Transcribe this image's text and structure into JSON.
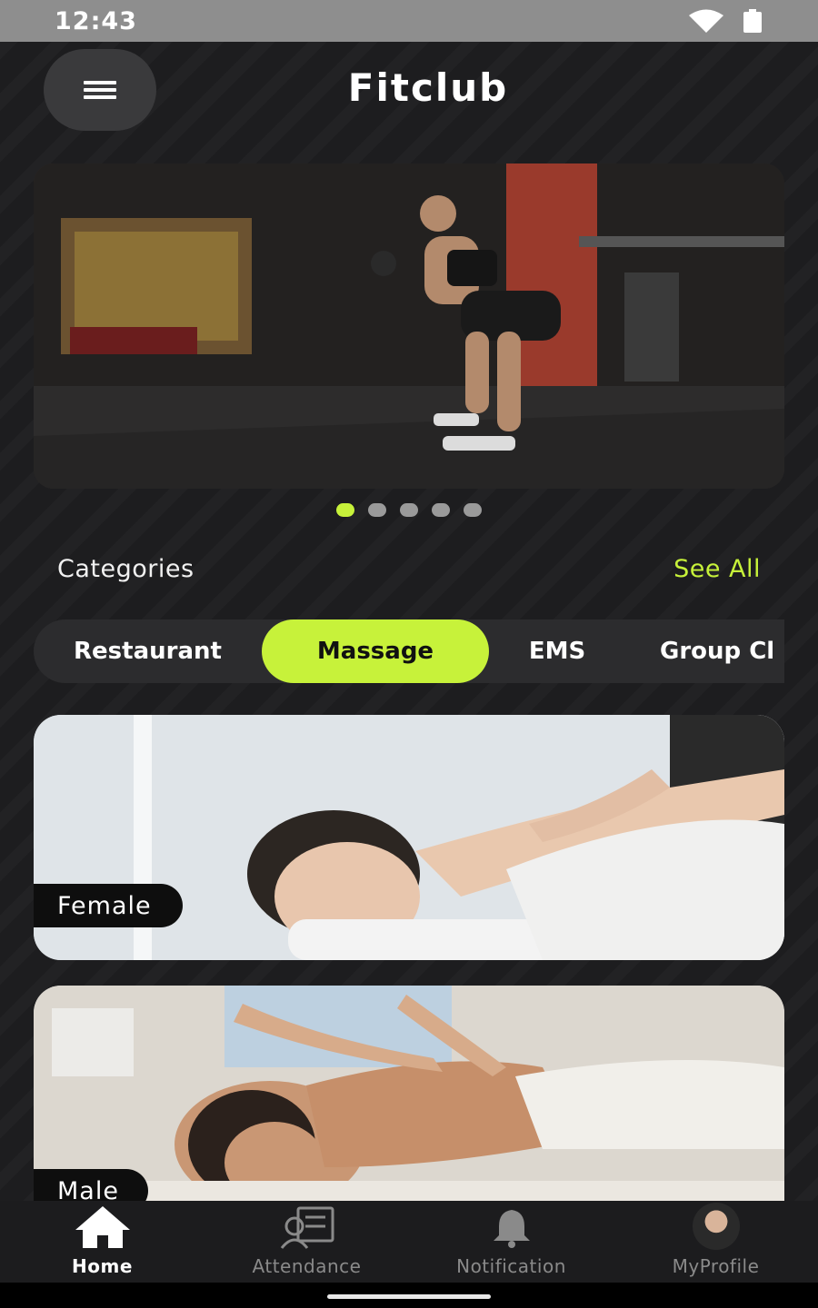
{
  "status_bar": {
    "time": "12:43",
    "icons": [
      "wifi-icon",
      "battery-icon"
    ]
  },
  "header": {
    "title": "Fitclub",
    "menu_icon": "hamburger-menu-icon"
  },
  "banner": {
    "image": "woman-squatting-in-gym-photo",
    "slide_count": 5,
    "active_slide": 1
  },
  "categories": {
    "title": "Categories",
    "see_all": "See All",
    "tabs": [
      {
        "label": "Restaurant",
        "active": false
      },
      {
        "label": "Massage",
        "active": true
      },
      {
        "label": "EMS",
        "active": false
      },
      {
        "label": "Group Cl",
        "active": false
      }
    ]
  },
  "cards": [
    {
      "label": "Female",
      "image": "female-massage-photo"
    },
    {
      "label": "Male",
      "image": "male-massage-photo"
    }
  ],
  "bottom_nav": [
    {
      "label": "Home",
      "icon": "home-icon",
      "active": true
    },
    {
      "label": "Attendance",
      "icon": "attendance-icon",
      "active": false
    },
    {
      "label": "Notification",
      "icon": "bell-icon",
      "active": false
    },
    {
      "label": "MyProfile",
      "icon": "avatar",
      "active": false
    }
  ],
  "colors": {
    "accent": "#c7f23a",
    "background": "#1d1d1f",
    "tab_bar": "#2c2c2e"
  }
}
